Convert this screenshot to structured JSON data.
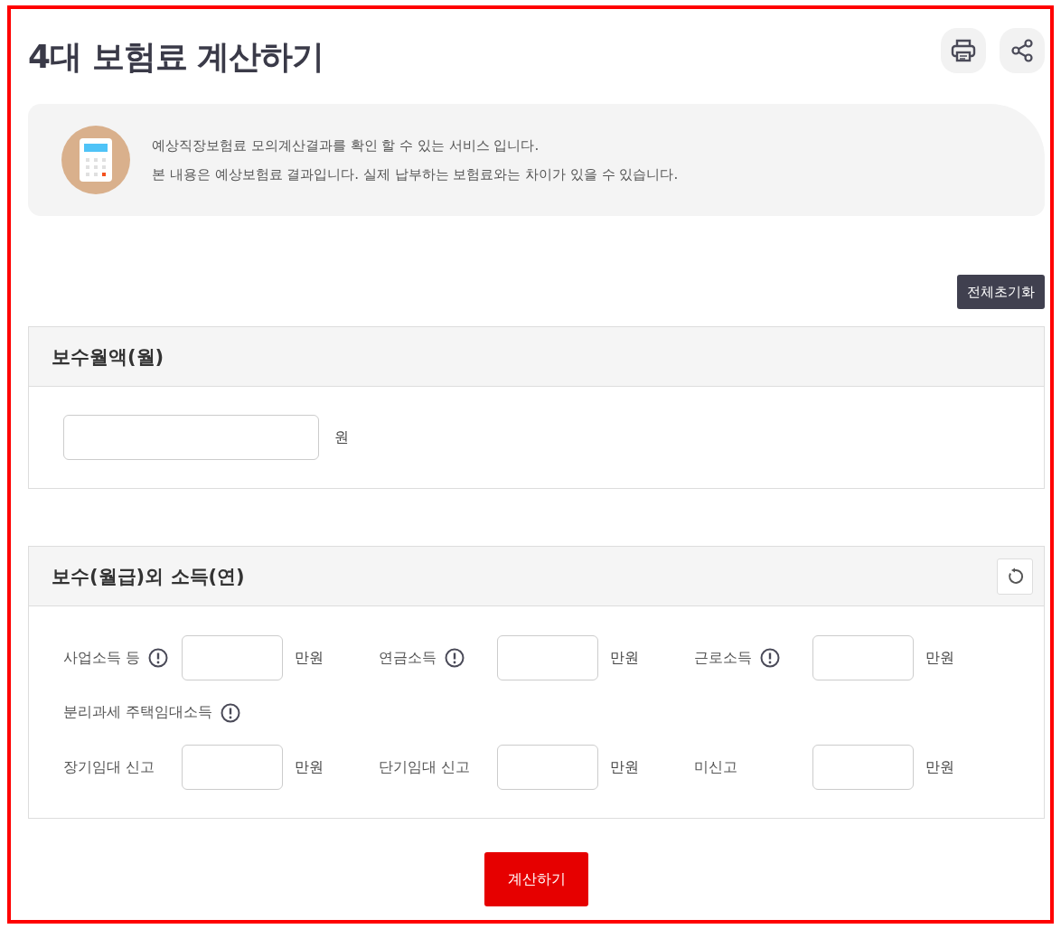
{
  "title": "4대 보험료 계산하기",
  "header_buttons": [
    {
      "kind": "print"
    },
    {
      "kind": "share"
    }
  ],
  "notice": {
    "lines": [
      "예상직장보험료 모의계산결과를 확인 할 수 있는 서비스 입니다.",
      "본 내용은 예상보험료 결과입니다. 실제 납부하는 보험료와는 차이가 있을 수 있습니다."
    ]
  },
  "reset_all_button": "전체초기화",
  "salary_section": {
    "title": "보수월액(월)",
    "unit": "원",
    "has_reset": false
  },
  "other_income_section": {
    "title": "보수(월급)외 소득(연)",
    "has_reset": true,
    "rows": [
      {
        "kind": "fields",
        "fields": [
          {
            "kind": "with-info",
            "label": "사업소득 등",
            "unit": "만원"
          },
          {
            "kind": "with-info",
            "label": "연금소득",
            "unit": "만원"
          },
          {
            "kind": "with-info",
            "label": "근로소득",
            "unit": "만원"
          }
        ]
      },
      {
        "kind": "heading-with-info",
        "label": "분리과세 주택임대소득"
      },
      {
        "kind": "fields",
        "fields": [
          {
            "kind": "plain",
            "label": "장기임대 신고",
            "unit": "만원"
          },
          {
            "kind": "plain",
            "label": "단기임대 신고",
            "unit": "만원"
          },
          {
            "kind": "plain",
            "label": "미신고",
            "unit": "만원"
          }
        ]
      }
    ]
  },
  "calculate_button": "계산하기"
}
